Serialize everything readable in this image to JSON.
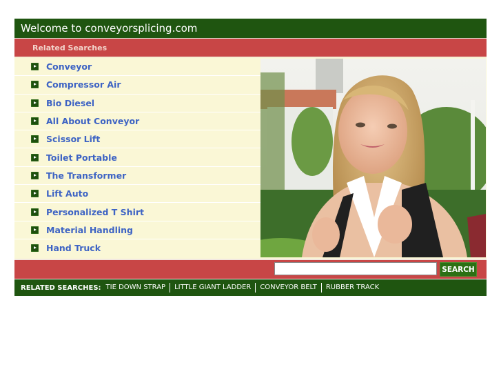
{
  "header": {
    "title": "Welcome to conveyorsplicing.com"
  },
  "related_bar": {
    "label": "Related Searches"
  },
  "links": [
    {
      "label": "Conveyor",
      "icon": "arrow-right-icon"
    },
    {
      "label": "Compressor Air",
      "icon": "arrow-right-icon"
    },
    {
      "label": "Bio Diesel",
      "icon": "arrow-right-icon"
    },
    {
      "label": "All About Conveyor",
      "icon": "arrow-right-icon"
    },
    {
      "label": "Scissor Lift",
      "icon": "arrow-right-icon"
    },
    {
      "label": "Toilet Portable",
      "icon": "arrow-right-icon"
    },
    {
      "label": "The Transformer",
      "icon": "arrow-right-icon"
    },
    {
      "label": "Lift Auto",
      "icon": "arrow-right-icon"
    },
    {
      "label": "Personalized T Shirt",
      "icon": "arrow-right-icon"
    },
    {
      "label": "Material Handling",
      "icon": "arrow-right-icon"
    },
    {
      "label": "Hand Truck",
      "icon": "arrow-right-icon"
    }
  ],
  "photo": {
    "alt": "Smiling young woman with a backpack outdoors"
  },
  "search": {
    "value": "",
    "placeholder": "",
    "button_label": "SEARCH"
  },
  "footer": {
    "label": "RELATED SEARCHES:",
    "links": [
      "TIE DOWN STRAP",
      "LITTLE GIANT LADDER",
      "CONVEYOR BELT",
      "RUBBER TRACK"
    ]
  },
  "colors": {
    "green": "#1f5510",
    "red": "#c84646",
    "cream": "#faf7d6",
    "link_blue": "#3d63c4"
  }
}
